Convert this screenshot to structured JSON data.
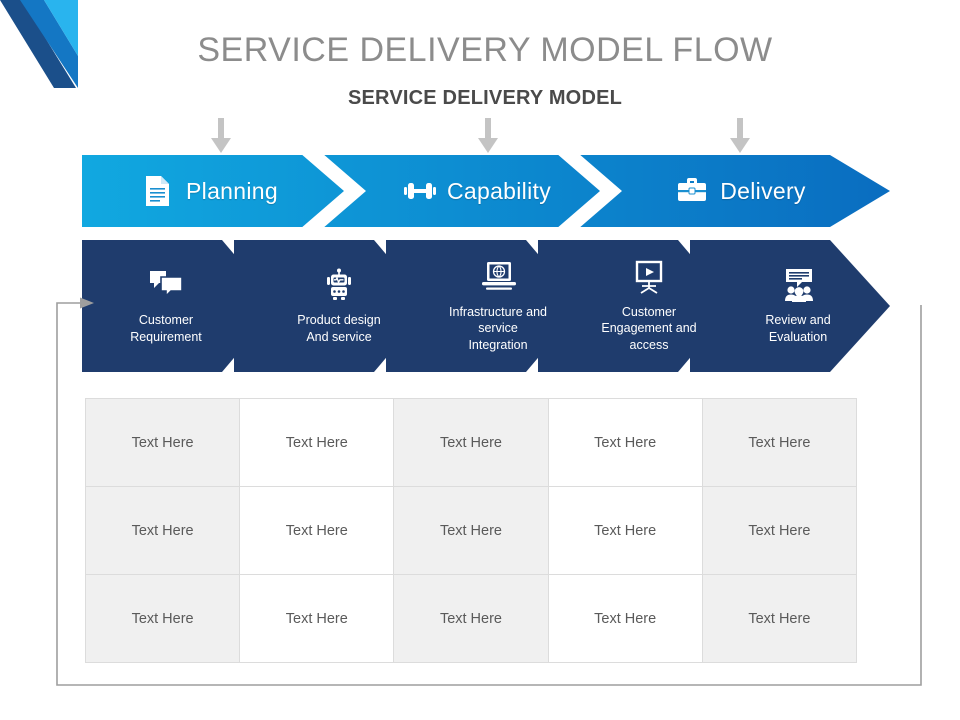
{
  "header": {
    "title": "SERVICE DELIVERY MODEL FLOW",
    "subtitle": "SERVICE DELIVERY MODEL",
    "title_color": "#8c8c8c",
    "subtitle_color": "#4a4a4a"
  },
  "logo": {
    "name": "company-logo",
    "colors": [
      "#1b4f8a",
      "#1477c4",
      "#29b4ee"
    ]
  },
  "colors": {
    "band_light_blue": "#11a8e0",
    "band_dark_blue": "#0a72c4",
    "navy": "#1f3c6d",
    "loop_line": "#9e9e9e",
    "down_arrow": "#c4c4c4",
    "table_shade": "#f0f0f0",
    "table_border": "#dcdcdc"
  },
  "top_band": {
    "stages": [
      {
        "label": "Planning",
        "icon": "document-icon"
      },
      {
        "label": "Capability",
        "icon": "dumbbell-icon"
      },
      {
        "label": "Delivery",
        "icon": "briefcase-icon"
      }
    ]
  },
  "down_arrows": [
    {
      "name": "down-arrow-planning"
    },
    {
      "name": "down-arrow-capability"
    },
    {
      "name": "down-arrow-delivery"
    }
  ],
  "navy_band": {
    "steps": [
      {
        "label": "Customer\nRequirement",
        "line1": "Customer",
        "line2": "Requirement",
        "line3": "",
        "icon": "chat-bubbles-icon"
      },
      {
        "label": "Product design\nAnd service",
        "line1": "Product design",
        "line2": "And service",
        "line3": "",
        "icon": "robot-icon"
      },
      {
        "label": "Infrastructure and\nservice\nIntegration",
        "line1": "Infrastructure and",
        "line2": "service",
        "line3": "Integration",
        "icon": "laptop-globe-icon"
      },
      {
        "label": "Customer\nEngagement and\naccess",
        "line1": "Customer",
        "line2": "Engagement and",
        "line3": "access",
        "icon": "presentation-screen-icon"
      },
      {
        "label": "Review and\nEvaluation",
        "line1": "Review and",
        "line2": "Evaluation",
        "line3": "",
        "icon": "group-feedback-icon"
      }
    ]
  },
  "feedback_loop": {
    "name": "feedback-loop-arrow",
    "description": "loop from last step back to first step"
  },
  "table": {
    "columns": 5,
    "rows": [
      [
        "Text Here",
        "Text Here",
        "Text Here",
        "Text Here",
        "Text Here"
      ],
      [
        "Text Here",
        "Text Here",
        "Text Here",
        "Text Here",
        "Text Here"
      ],
      [
        "Text Here",
        "Text Here",
        "Text Here",
        "Text Here",
        "Text Here"
      ]
    ],
    "shaded_columns": [
      0,
      2,
      4
    ]
  }
}
